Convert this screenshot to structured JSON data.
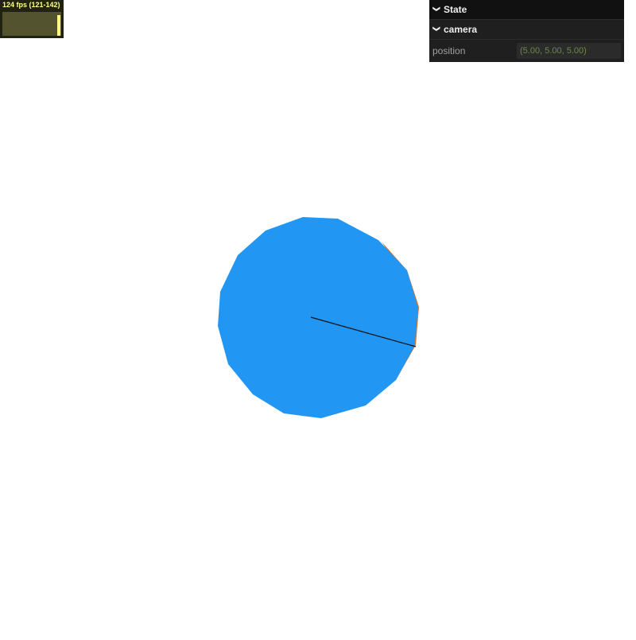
{
  "stats": {
    "fps_label": "124 fps (121-142)",
    "fps_level": 0.87,
    "accent": "#ffff88"
  },
  "gui": {
    "title": "State",
    "folder": "camera",
    "properties": [
      {
        "name": "position",
        "value": "(5.00, 5.00, 5.00)"
      }
    ]
  },
  "scene": {
    "disc_color": "#2196f3",
    "rim_color": "#c8743a",
    "needle_color": "#111111"
  }
}
